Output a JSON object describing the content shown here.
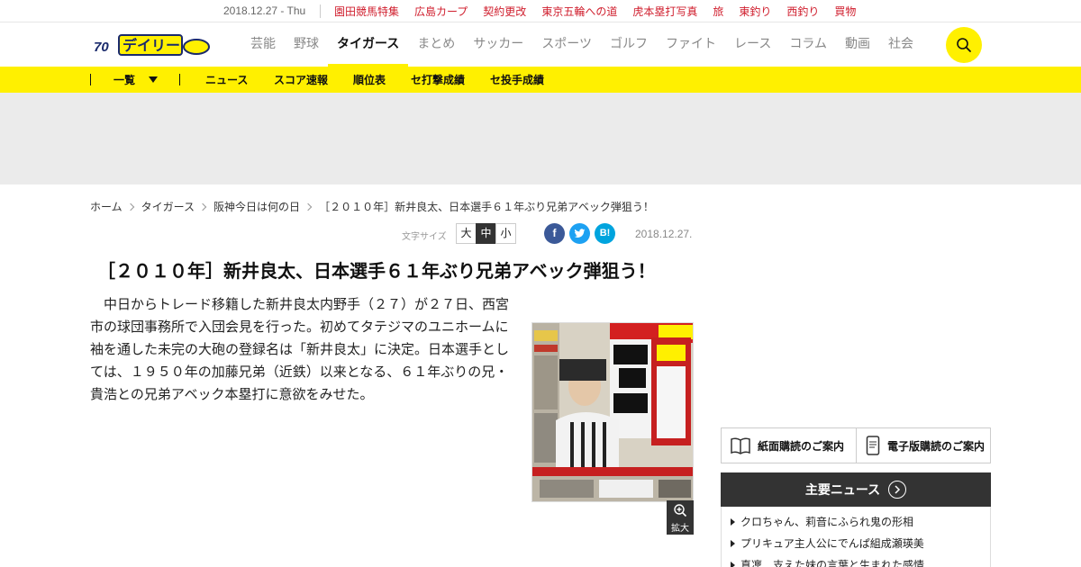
{
  "topbar": {
    "date": "2018.12.27 - Thu",
    "links": [
      "園田競馬特集",
      "広島カープ",
      "契約更改",
      "東京五輪への道",
      "虎本塁打写真",
      "旅",
      "東釣り",
      "西釣り",
      "買物"
    ]
  },
  "header": {
    "logo_alt": "デイリー",
    "nav": [
      "芸能",
      "野球",
      "タイガース",
      "まとめ",
      "サッカー",
      "スポーツ",
      "ゴルフ",
      "ファイト",
      "レース",
      "コラム",
      "動画",
      "社会"
    ],
    "active_nav": "タイガース",
    "search_icon": "search-icon"
  },
  "subnav": {
    "list_label": "一覧",
    "items": [
      "ニュース",
      "スコア速報",
      "順位表",
      "セ打撃成績",
      "セ投手成績"
    ]
  },
  "breadcrumb": [
    "ホーム",
    "タイガース",
    "阪神今日は何の日",
    "［２０１０年］新井良太、日本選手６１年ぶり兄弟アベック弾狙う！"
  ],
  "tools": {
    "font_size_label": "文字サイズ",
    "font_sizes": [
      "大",
      "中",
      "小"
    ],
    "selected_size": "中",
    "share": {
      "facebook": "f",
      "hatena": "B!"
    },
    "date": "2018.12.27."
  },
  "article": {
    "headline": "［２０１０年］新井良太、日本選手６１年ぶり兄弟アベック弾狙う！",
    "body": "中日からトレード移籍した新井良太内野手（２７）が２７日、西宮市の球団事務所で入団会見を行った。初めてタテジマのユニホームに袖を通した未完の大砲の登録名は「新井良太」に決定。日本選手としては、１９５０年の加藤兄弟（近鉄）以来となる、６１年ぶりの兄・貴浩との兄弟アベック本塁打に意欲をみせた。",
    "zoom_label": "拡大"
  },
  "sidebar": {
    "subscribe_paper": "紙面購読のご案内",
    "subscribe_digital": "電子版購読のご案内",
    "topnews_title": "主要ニュース",
    "topnews": [
      "クロちゃん、莉音にふられ鬼の形相",
      "プリキュア主人公にでんぱ組成瀬瑛美",
      "真凜　支えた妹の言葉と生まれた感情"
    ]
  },
  "colors": {
    "accent_yellow": "#fff000",
    "link_red": "#d0202f",
    "facebook": "#3b5998",
    "twitter": "#1da1f2",
    "hatena": "#00a4de",
    "dark": "#333333"
  }
}
